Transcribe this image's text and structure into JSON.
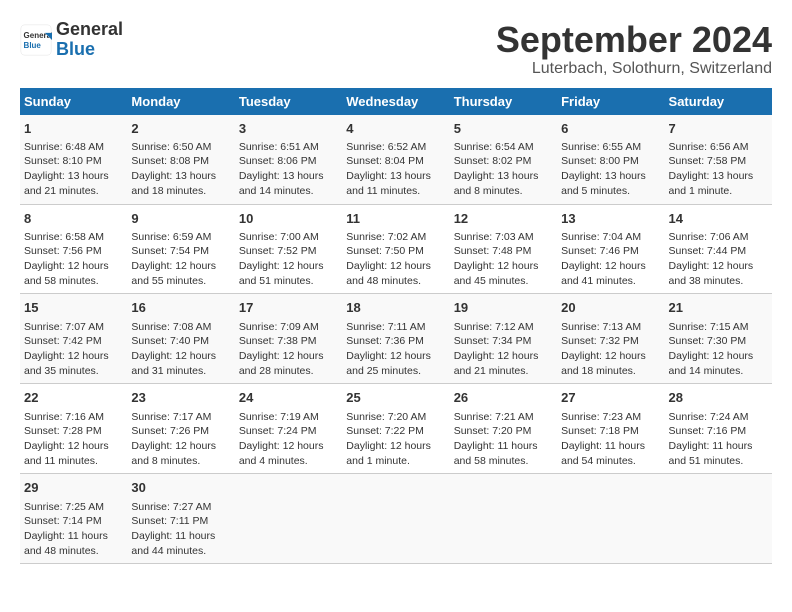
{
  "header": {
    "logo_general": "General",
    "logo_blue": "Blue",
    "month_title": "September 2024",
    "location": "Luterbach, Solothurn, Switzerland"
  },
  "days_of_week": [
    "Sunday",
    "Monday",
    "Tuesday",
    "Wednesday",
    "Thursday",
    "Friday",
    "Saturday"
  ],
  "weeks": [
    [
      {
        "day": "1",
        "lines": [
          "Sunrise: 6:48 AM",
          "Sunset: 8:10 PM",
          "Daylight: 13 hours",
          "and 21 minutes."
        ]
      },
      {
        "day": "2",
        "lines": [
          "Sunrise: 6:50 AM",
          "Sunset: 8:08 PM",
          "Daylight: 13 hours",
          "and 18 minutes."
        ]
      },
      {
        "day": "3",
        "lines": [
          "Sunrise: 6:51 AM",
          "Sunset: 8:06 PM",
          "Daylight: 13 hours",
          "and 14 minutes."
        ]
      },
      {
        "day": "4",
        "lines": [
          "Sunrise: 6:52 AM",
          "Sunset: 8:04 PM",
          "Daylight: 13 hours",
          "and 11 minutes."
        ]
      },
      {
        "day": "5",
        "lines": [
          "Sunrise: 6:54 AM",
          "Sunset: 8:02 PM",
          "Daylight: 13 hours",
          "and 8 minutes."
        ]
      },
      {
        "day": "6",
        "lines": [
          "Sunrise: 6:55 AM",
          "Sunset: 8:00 PM",
          "Daylight: 13 hours",
          "and 5 minutes."
        ]
      },
      {
        "day": "7",
        "lines": [
          "Sunrise: 6:56 AM",
          "Sunset: 7:58 PM",
          "Daylight: 13 hours",
          "and 1 minute."
        ]
      }
    ],
    [
      {
        "day": "8",
        "lines": [
          "Sunrise: 6:58 AM",
          "Sunset: 7:56 PM",
          "Daylight: 12 hours",
          "and 58 minutes."
        ]
      },
      {
        "day": "9",
        "lines": [
          "Sunrise: 6:59 AM",
          "Sunset: 7:54 PM",
          "Daylight: 12 hours",
          "and 55 minutes."
        ]
      },
      {
        "day": "10",
        "lines": [
          "Sunrise: 7:00 AM",
          "Sunset: 7:52 PM",
          "Daylight: 12 hours",
          "and 51 minutes."
        ]
      },
      {
        "day": "11",
        "lines": [
          "Sunrise: 7:02 AM",
          "Sunset: 7:50 PM",
          "Daylight: 12 hours",
          "and 48 minutes."
        ]
      },
      {
        "day": "12",
        "lines": [
          "Sunrise: 7:03 AM",
          "Sunset: 7:48 PM",
          "Daylight: 12 hours",
          "and 45 minutes."
        ]
      },
      {
        "day": "13",
        "lines": [
          "Sunrise: 7:04 AM",
          "Sunset: 7:46 PM",
          "Daylight: 12 hours",
          "and 41 minutes."
        ]
      },
      {
        "day": "14",
        "lines": [
          "Sunrise: 7:06 AM",
          "Sunset: 7:44 PM",
          "Daylight: 12 hours",
          "and 38 minutes."
        ]
      }
    ],
    [
      {
        "day": "15",
        "lines": [
          "Sunrise: 7:07 AM",
          "Sunset: 7:42 PM",
          "Daylight: 12 hours",
          "and 35 minutes."
        ]
      },
      {
        "day": "16",
        "lines": [
          "Sunrise: 7:08 AM",
          "Sunset: 7:40 PM",
          "Daylight: 12 hours",
          "and 31 minutes."
        ]
      },
      {
        "day": "17",
        "lines": [
          "Sunrise: 7:09 AM",
          "Sunset: 7:38 PM",
          "Daylight: 12 hours",
          "and 28 minutes."
        ]
      },
      {
        "day": "18",
        "lines": [
          "Sunrise: 7:11 AM",
          "Sunset: 7:36 PM",
          "Daylight: 12 hours",
          "and 25 minutes."
        ]
      },
      {
        "day": "19",
        "lines": [
          "Sunrise: 7:12 AM",
          "Sunset: 7:34 PM",
          "Daylight: 12 hours",
          "and 21 minutes."
        ]
      },
      {
        "day": "20",
        "lines": [
          "Sunrise: 7:13 AM",
          "Sunset: 7:32 PM",
          "Daylight: 12 hours",
          "and 18 minutes."
        ]
      },
      {
        "day": "21",
        "lines": [
          "Sunrise: 7:15 AM",
          "Sunset: 7:30 PM",
          "Daylight: 12 hours",
          "and 14 minutes."
        ]
      }
    ],
    [
      {
        "day": "22",
        "lines": [
          "Sunrise: 7:16 AM",
          "Sunset: 7:28 PM",
          "Daylight: 12 hours",
          "and 11 minutes."
        ]
      },
      {
        "day": "23",
        "lines": [
          "Sunrise: 7:17 AM",
          "Sunset: 7:26 PM",
          "Daylight: 12 hours",
          "and 8 minutes."
        ]
      },
      {
        "day": "24",
        "lines": [
          "Sunrise: 7:19 AM",
          "Sunset: 7:24 PM",
          "Daylight: 12 hours",
          "and 4 minutes."
        ]
      },
      {
        "day": "25",
        "lines": [
          "Sunrise: 7:20 AM",
          "Sunset: 7:22 PM",
          "Daylight: 12 hours",
          "and 1 minute."
        ]
      },
      {
        "day": "26",
        "lines": [
          "Sunrise: 7:21 AM",
          "Sunset: 7:20 PM",
          "Daylight: 11 hours",
          "and 58 minutes."
        ]
      },
      {
        "day": "27",
        "lines": [
          "Sunrise: 7:23 AM",
          "Sunset: 7:18 PM",
          "Daylight: 11 hours",
          "and 54 minutes."
        ]
      },
      {
        "day": "28",
        "lines": [
          "Sunrise: 7:24 AM",
          "Sunset: 7:16 PM",
          "Daylight: 11 hours",
          "and 51 minutes."
        ]
      }
    ],
    [
      {
        "day": "29",
        "lines": [
          "Sunrise: 7:25 AM",
          "Sunset: 7:14 PM",
          "Daylight: 11 hours",
          "and 48 minutes."
        ]
      },
      {
        "day": "30",
        "lines": [
          "Sunrise: 7:27 AM",
          "Sunset: 7:11 PM",
          "Daylight: 11 hours",
          "and 44 minutes."
        ]
      },
      {
        "day": "",
        "lines": []
      },
      {
        "day": "",
        "lines": []
      },
      {
        "day": "",
        "lines": []
      },
      {
        "day": "",
        "lines": []
      },
      {
        "day": "",
        "lines": []
      }
    ]
  ]
}
